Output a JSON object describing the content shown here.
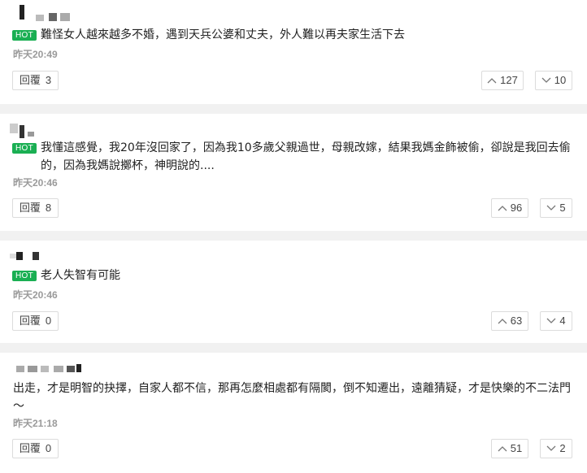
{
  "comments": [
    {
      "hot_label": "HOT",
      "text": "難怪女人越來越多不婚，遇到天兵公婆和丈夫，外人難以再夫家生活下去",
      "time": "昨天20:49",
      "reply_label": "回覆",
      "reply_count": "3",
      "up_count": "127",
      "down_count": "10"
    },
    {
      "hot_label": "HOT",
      "text": "我懂這感覺，我20年沒回家了，因為我10多歲父親過世，母親改嫁，結果我媽金飾被偷，卻說是我回去偷的，因為我媽說擲杯，神明說的....",
      "time": "昨天20:46",
      "reply_label": "回覆",
      "reply_count": "8",
      "up_count": "96",
      "down_count": "5"
    },
    {
      "hot_label": "HOT",
      "text": "老人失智有可能",
      "time": "昨天20:46",
      "reply_label": "回覆",
      "reply_count": "0",
      "up_count": "63",
      "down_count": "4"
    },
    {
      "text": "出走，才是明智的抉擇，自家人都不信，那再怎麼相處都有隔閡，倒不知遷出，遠離猜疑，才是快樂的不二法門～",
      "time": "昨天21:18",
      "reply_label": "回覆",
      "reply_count": "0",
      "up_count": "51",
      "down_count": "2"
    }
  ],
  "colors": {
    "hot_badge": "#1aaf53",
    "time_text": "#9a9a9a",
    "separator": "#f1f1f1"
  },
  "icons": [
    "chevron-up-icon",
    "chevron-down-icon"
  ]
}
